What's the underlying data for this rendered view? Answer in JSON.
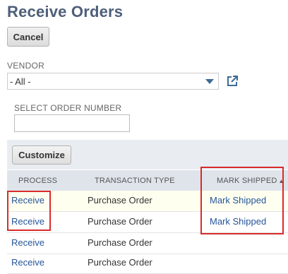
{
  "page": {
    "title": "Receive Orders"
  },
  "actions": {
    "cancel_label": "Cancel",
    "customize_label": "Customize"
  },
  "vendor": {
    "label": "VENDOR",
    "selected": "- All -",
    "open_icon": "external-link-icon"
  },
  "order_number": {
    "label": "SELECT ORDER NUMBER",
    "value": ""
  },
  "table": {
    "columns": {
      "process": "PROCESS",
      "type": "TRANSACTION TYPE",
      "mark": "MARK SHIPPED",
      "sort_indicator": "▲"
    },
    "rows": [
      {
        "process": "Receive",
        "type": "Purchase Order",
        "mark": "Mark Shipped"
      },
      {
        "process": "Receive",
        "type": "Purchase Order",
        "mark": "Mark Shipped"
      },
      {
        "process": "Receive",
        "type": "Purchase Order",
        "mark": ""
      },
      {
        "process": "Receive",
        "type": "Purchase Order",
        "mark": ""
      }
    ]
  },
  "colors": {
    "title": "#4d5f79",
    "link": "#255599",
    "highlight_box": "#d92b2b",
    "header_bg": "#dfe4eb"
  }
}
